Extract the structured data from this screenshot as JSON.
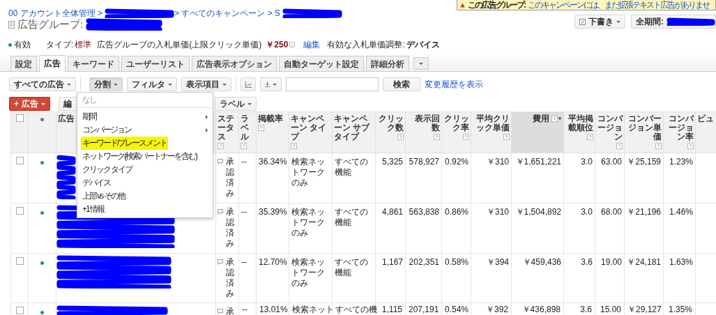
{
  "notice": {
    "title": "この広告グループ:",
    "text": "このキャンペーンには、まだ拡張テキスト広告がありませ"
  },
  "breadcrumb": [
    {
      "kind": "link",
      "text": "00 アカウント全体管理 >"
    },
    {
      "kind": "redacted"
    },
    {
      "kind": "link",
      "text": "> すべてのキャンペーン >"
    },
    {
      "kind": "link",
      "text": "S"
    },
    {
      "kind": "redacted"
    }
  ],
  "title": {
    "label": "広告グループ:"
  },
  "draft_button": "下書き",
  "date_button": {
    "label": "全期間:"
  },
  "status_line": {
    "state": "有効",
    "enabled": true,
    "type_label": "タイプ:",
    "type_value": "標準",
    "bid_label": "広告グループの入札単価(上限クリック単価)",
    "bid_value": "￥250",
    "edit_link": "編集",
    "adjust_label": "有効な入札単価調整:",
    "adjust_value": "デバイス"
  },
  "tabs": [
    {
      "label": "設定",
      "selected": false
    },
    {
      "label": "広告",
      "selected": true
    },
    {
      "label": "キーワード",
      "selected": false
    },
    {
      "label": "ユーザーリスト",
      "selected": false
    },
    {
      "label": "広告表示オプション",
      "selected": false
    },
    {
      "label": "自動ターゲット設定",
      "selected": false
    },
    {
      "label": "詳細分析",
      "selected": false
    }
  ],
  "toolbar": [
    {
      "kind": "dropdown",
      "label": "すべての広告",
      "active": false
    },
    {
      "kind": "divider"
    },
    {
      "kind": "dropdown",
      "label": "分割",
      "active": true
    },
    {
      "kind": "dropdown",
      "label": "フィルタ",
      "active": false
    },
    {
      "kind": "dropdown",
      "label": "表示項目",
      "active": false
    },
    {
      "kind": "divider"
    },
    {
      "kind": "chart"
    },
    {
      "kind": "download"
    },
    {
      "kind": "search"
    },
    {
      "kind": "button",
      "label": "検索",
      "active": false
    },
    {
      "kind": "link",
      "label": "変更履歴を表示"
    }
  ],
  "actions": [
    {
      "kind": "primary",
      "label": "広告",
      "plus": "+"
    },
    {
      "kind": "plain",
      "label": "編"
    },
    {
      "kind": "dropdown",
      "label": "ラベル"
    }
  ],
  "segment_menu": [
    {
      "label": "なし",
      "disabled": true,
      "submenu": false,
      "highlighted": false
    },
    {
      "label": "期間",
      "disabled": false,
      "submenu": true,
      "highlighted": false
    },
    {
      "label": "コンバージョン",
      "disabled": false,
      "submenu": true,
      "highlighted": false
    },
    {
      "label": "キーワード/プレースメント",
      "disabled": false,
      "submenu": false,
      "highlighted": true
    },
    {
      "label": "ネットワーク(検索パートナーを含む)",
      "disabled": false,
      "submenu": false,
      "highlighted": false
    },
    {
      "label": "クリック タイプ",
      "disabled": false,
      "submenu": false,
      "highlighted": false
    },
    {
      "label": "デバイス",
      "disabled": false,
      "submenu": false,
      "highlighted": false
    },
    {
      "label": "上部 vs その他",
      "disabled": false,
      "submenu": false,
      "highlighted": false
    },
    {
      "label": "+1 情報",
      "disabled": false,
      "submenu": false,
      "highlighted": false
    }
  ],
  "table": {
    "select_all_checked": false,
    "ad_header": "広告",
    "columns": [
      {
        "kind": "text",
        "label": "ステータス",
        "help": true,
        "sorted": false
      },
      {
        "kind": "text",
        "label": "ラベル",
        "help": true,
        "sorted": false
      },
      {
        "kind": "text",
        "label": "掲載率",
        "help": true,
        "sorted": false
      },
      {
        "kind": "text",
        "label": "キャンペーン タイプ",
        "help": true,
        "sorted": false
      },
      {
        "kind": "text",
        "label": "キャンペーン サブタイプ",
        "help": false,
        "sorted": false
      },
      {
        "kind": "num",
        "label": "クリック数",
        "help": true,
        "sorted": false
      },
      {
        "kind": "num",
        "label": "表示回数",
        "help": true,
        "sorted": false
      },
      {
        "kind": "num",
        "label": "クリック率",
        "help": true,
        "sorted": false
      },
      {
        "kind": "num",
        "label": "平均クリック単価",
        "help": true,
        "sorted": false
      },
      {
        "kind": "num",
        "label": "費用",
        "help": true,
        "sorted": true
      },
      {
        "kind": "num",
        "label": "平均掲載順位",
        "help": true,
        "sorted": false
      },
      {
        "kind": "num",
        "label": "コンバージョン",
        "help": true,
        "sorted": false
      },
      {
        "kind": "num",
        "label": "コンバージョン単価",
        "help": true,
        "sorted": false
      },
      {
        "kind": "num",
        "label": "コンバージョン率",
        "help": true,
        "sorted": false
      },
      {
        "kind": "text",
        "label": "ビュ",
        "help": false,
        "sorted": false
      }
    ],
    "rows": [
      {
        "checked": false,
        "enabled": true,
        "cells": [
          "承認済み",
          "--",
          "36.34%",
          "検索ネットワークのみ",
          "すべての機能",
          "5,325",
          "578,927",
          "0.92%",
          "￥310",
          "￥1,651,221",
          "3.0",
          "63.00",
          "￥25,159",
          "1.23%"
        ]
      },
      {
        "checked": false,
        "enabled": true,
        "cells": [
          "承認済み",
          "--",
          "35.39%",
          "検索ネットワークのみ",
          "すべての機能",
          "4,861",
          "563,838",
          "0.86%",
          "￥310",
          "￥1,504,892",
          "3.0",
          "68.00",
          "￥21,196",
          "1.46%"
        ]
      },
      {
        "checked": false,
        "enabled": true,
        "cells": [
          "承認済み",
          "--",
          "12.70%",
          "検索ネットワークのみ",
          "すべての機能",
          "1,167",
          "202,351",
          "0.58%",
          "￥394",
          "￥459,436",
          "3.6",
          "19.00",
          "￥24,181",
          "1.63%"
        ]
      },
      {
        "checked": false,
        "enabled": true,
        "cells": [
          "承",
          "--",
          "13.01%",
          "検索ネット",
          "すべての機",
          "1,115",
          "207,191",
          "0.54%",
          "￥392",
          "￥436,898",
          "3.6",
          "15.00",
          "￥29,127",
          "1.35%"
        ]
      }
    ]
  }
}
